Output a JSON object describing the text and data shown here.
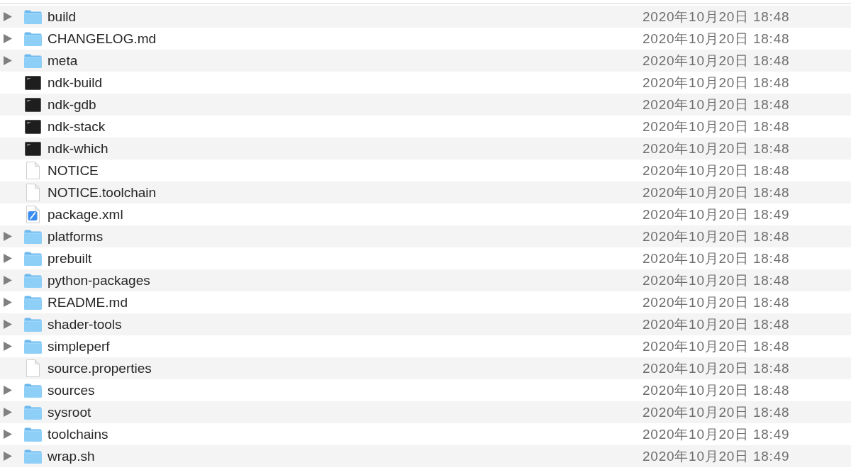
{
  "rows": [
    {
      "name": "build",
      "kind": "folder",
      "modified": "2020年10月20日 18:48"
    },
    {
      "name": "CHANGELOG.md",
      "kind": "folder",
      "modified": "2020年10月20日 18:48"
    },
    {
      "name": "meta",
      "kind": "folder",
      "modified": "2020年10月20日 18:48"
    },
    {
      "name": "ndk-build",
      "kind": "executable",
      "modified": "2020年10月20日 18:48"
    },
    {
      "name": "ndk-gdb",
      "kind": "executable",
      "modified": "2020年10月20日 18:48"
    },
    {
      "name": "ndk-stack",
      "kind": "executable",
      "modified": "2020年10月20日 18:48"
    },
    {
      "name": "ndk-which",
      "kind": "executable",
      "modified": "2020年10月20日 18:48"
    },
    {
      "name": "NOTICE",
      "kind": "document",
      "modified": "2020年10月20日 18:48"
    },
    {
      "name": "NOTICE.toolchain",
      "kind": "document",
      "modified": "2020年10月20日 18:48"
    },
    {
      "name": "package.xml",
      "kind": "xml",
      "modified": "2020年10月20日 18:49"
    },
    {
      "name": "platforms",
      "kind": "folder",
      "modified": "2020年10月20日 18:48"
    },
    {
      "name": "prebuilt",
      "kind": "folder",
      "modified": "2020年10月20日 18:48"
    },
    {
      "name": "python-packages",
      "kind": "folder",
      "modified": "2020年10月20日 18:48"
    },
    {
      "name": "README.md",
      "kind": "folder",
      "modified": "2020年10月20日 18:48"
    },
    {
      "name": "shader-tools",
      "kind": "folder",
      "modified": "2020年10月20日 18:48"
    },
    {
      "name": "simpleperf",
      "kind": "folder",
      "modified": "2020年10月20日 18:48"
    },
    {
      "name": "source.properties",
      "kind": "document",
      "modified": "2020年10月20日 18:48"
    },
    {
      "name": "sources",
      "kind": "folder",
      "modified": "2020年10月20日 18:48"
    },
    {
      "name": "sysroot",
      "kind": "folder",
      "modified": "2020年10月20日 18:48"
    },
    {
      "name": "toolchains",
      "kind": "folder",
      "modified": "2020年10月20日 18:49"
    },
    {
      "name": "wrap.sh",
      "kind": "folder",
      "modified": "2020年10月20日 18:49"
    }
  ]
}
